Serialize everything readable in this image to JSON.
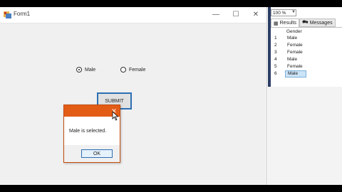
{
  "form": {
    "title": "Form1",
    "controls": {
      "minimize": "—",
      "maximize": "☐",
      "close": "✕"
    },
    "radios": [
      {
        "label": "Male",
        "checked": true
      },
      {
        "label": "Female",
        "checked": false
      }
    ],
    "submit_label": "SUBMIT"
  },
  "message_box": {
    "text": "Male is selected.",
    "ok_label": "OK",
    "close_glyph": "✕",
    "title_color": "#e35c16"
  },
  "results_panel": {
    "zoom": "100 %",
    "tabs": [
      "Results",
      "Messages"
    ],
    "column_header": "Gender",
    "rows": [
      {
        "num": "1",
        "value": "Male"
      },
      {
        "num": "2",
        "value": "Female"
      },
      {
        "num": "3",
        "value": "Female"
      },
      {
        "num": "4",
        "value": "Male"
      },
      {
        "num": "5",
        "value": "Female"
      },
      {
        "num": "6",
        "value": "Male",
        "selected": true
      }
    ]
  }
}
